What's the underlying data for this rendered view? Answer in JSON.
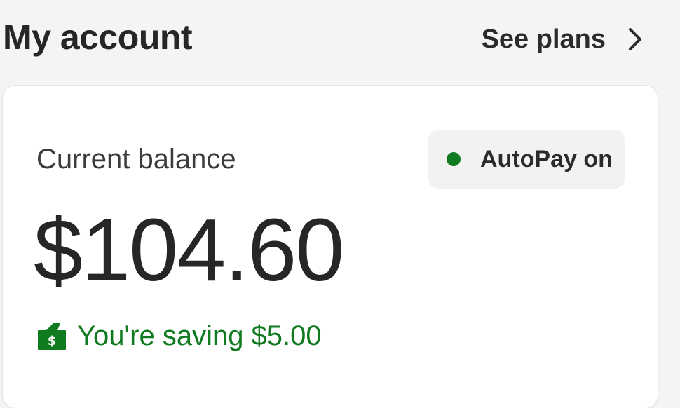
{
  "header": {
    "title": "My account",
    "see_plans_label": "See plans"
  },
  "balance_card": {
    "label": "Current balance",
    "amount": "$104.60",
    "autopay_label": "AutoPay on",
    "savings_text": "You're saving $5.00"
  },
  "colors": {
    "accent_green": "#0f7a1f",
    "background": "#f4f4f4",
    "card": "#ffffff",
    "text_primary": "#262626"
  },
  "icons": {
    "see_plans": "chevron-right-icon",
    "autopay_status": "status-dot-icon",
    "savings": "money-wallet-icon"
  }
}
